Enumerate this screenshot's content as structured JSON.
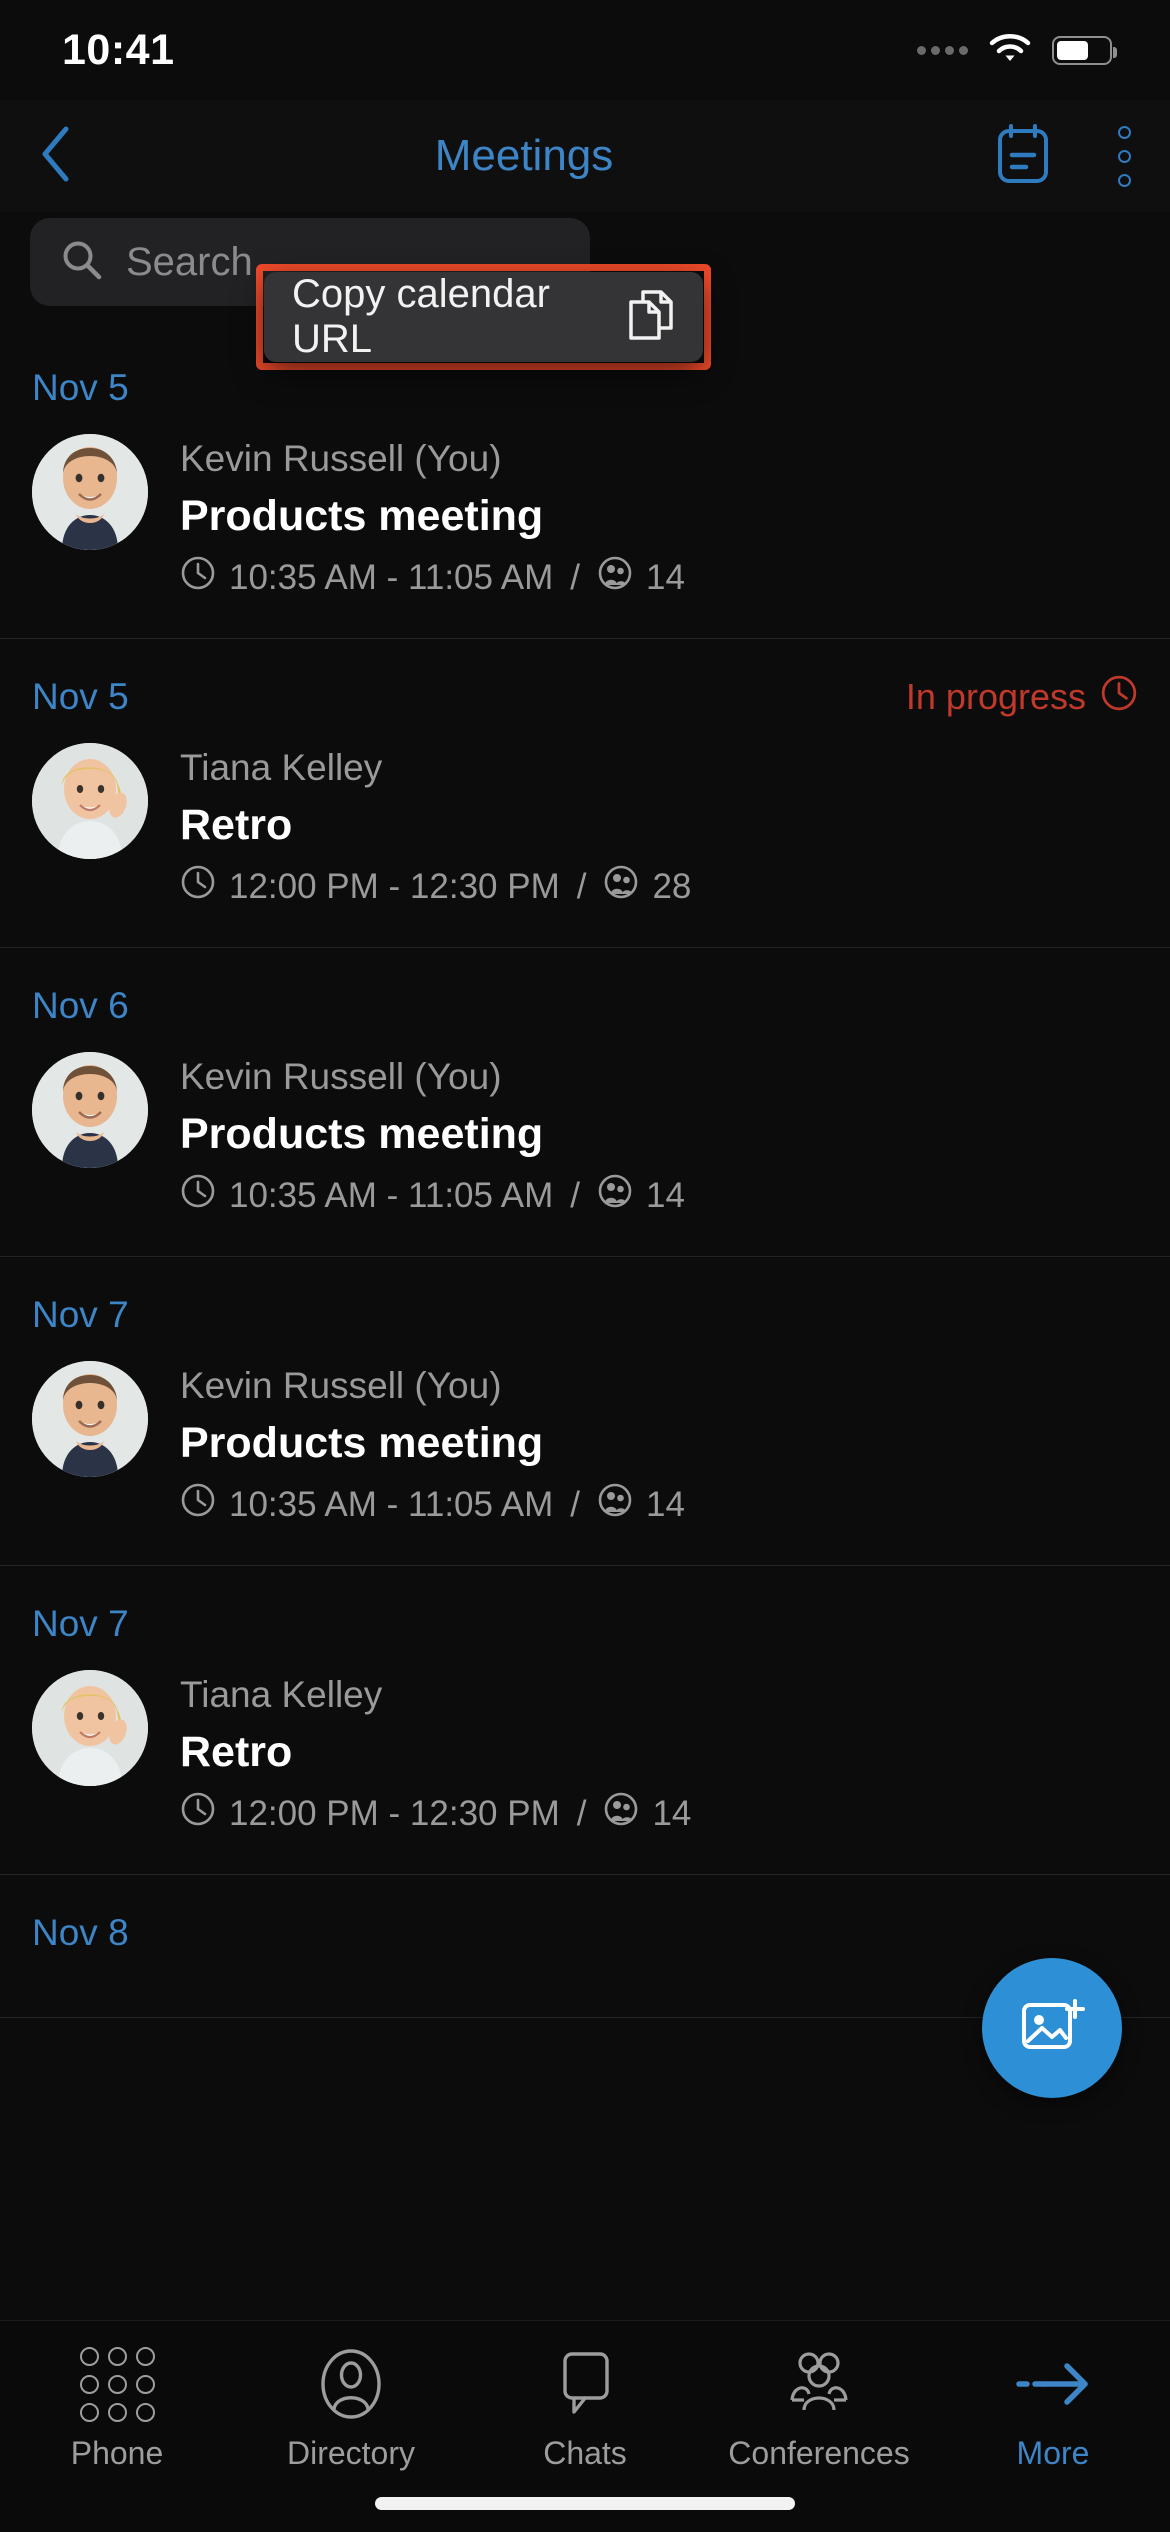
{
  "status_bar": {
    "time": "10:41",
    "wifi_icon": "wifi-icon",
    "battery_icon": "battery-icon",
    "signal_icon": "signal-dots-icon"
  },
  "header": {
    "back_icon": "chevron-left-icon",
    "title": "Meetings",
    "calendar_icon": "calendar-icon",
    "overflow_icon": "more-vertical-icon",
    "title_color": "#3d85c6"
  },
  "search": {
    "placeholder": "Search",
    "icon": "search-icon"
  },
  "popup_menu": {
    "highlight_color": "#ef4a2a",
    "items": [
      {
        "label": "Copy calendar URL",
        "icon": "copy-icon"
      }
    ]
  },
  "meetings": [
    {
      "date": "Nov 5",
      "owner": "Kevin Russell (You)",
      "title": "Products meeting",
      "time": "10:35 AM - 11:05 AM",
      "separator": "/",
      "participants": "14",
      "status": "",
      "avatar": "male-avatar"
    },
    {
      "date": "Nov 5",
      "owner": "Tiana Kelley",
      "title": "Retro",
      "time": "12:00 PM - 12:30 PM",
      "separator": "/",
      "participants": "28",
      "status": "In progress",
      "avatar": "female-avatar"
    },
    {
      "date": "Nov 6",
      "owner": "Kevin Russell (You)",
      "title": "Products meeting",
      "time": "10:35 AM - 11:05 AM",
      "separator": "/",
      "participants": "14",
      "status": "",
      "avatar": "male-avatar"
    },
    {
      "date": "Nov 7",
      "owner": "Kevin Russell (You)",
      "title": "Products meeting",
      "time": "10:35 AM - 11:05 AM",
      "separator": "/",
      "participants": "14",
      "status": "",
      "avatar": "male-avatar"
    },
    {
      "date": "Nov 7",
      "owner": "Tiana Kelley",
      "title": "Retro",
      "time": "12:00 PM - 12:30 PM",
      "separator": "/",
      "participants": "14",
      "status": "",
      "avatar": "female-avatar"
    },
    {
      "date": "Nov 8",
      "owner": "",
      "title": "",
      "time": "",
      "separator": "",
      "participants": "",
      "status": "",
      "avatar": ""
    }
  ],
  "fab": {
    "icon": "add-image-icon",
    "color": "#2d8fd5"
  },
  "tabbar": {
    "items": [
      {
        "label": "Phone",
        "icon": "dialpad-icon",
        "active": false
      },
      {
        "label": "Directory",
        "icon": "contact-icon",
        "active": false
      },
      {
        "label": "Chats",
        "icon": "chat-bubble-icon",
        "active": false
      },
      {
        "label": "Conferences",
        "icon": "group-icon",
        "active": false
      },
      {
        "label": "More",
        "icon": "arrow-right-icon",
        "active": true
      }
    ],
    "active_color": "#3d85c6",
    "inactive_color": "#9d9d9d"
  }
}
